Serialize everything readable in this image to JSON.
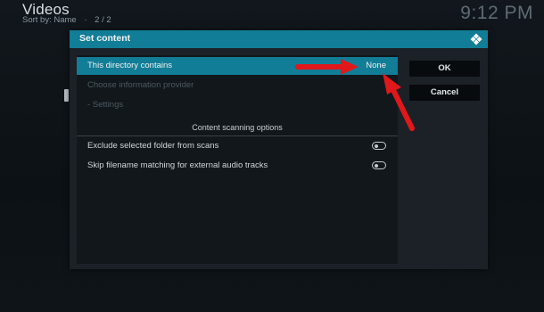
{
  "background": {
    "title": "Videos",
    "sort": "Sort by: Name",
    "page": "2 / 2",
    "clock": "9:12 PM"
  },
  "dialog": {
    "title": "Set content",
    "settings": {
      "content_label": "This directory contains",
      "content_value": "None",
      "provider_label": "Choose information provider",
      "settings_label": "- Settings",
      "section_header": "Content scanning options",
      "exclude_label": "Exclude selected folder from scans",
      "skip_label": "Skip filename matching for external audio tracks"
    },
    "buttons": {
      "ok": "OK",
      "cancel": "Cancel"
    }
  },
  "colors": {
    "accent": "#127d96",
    "dialog_bg": "#1b2126",
    "panel_bg": "#11171b",
    "arrow": "#e0171b"
  },
  "icons": [
    "kodi-logo-icon",
    "toggle-off-icon",
    "annotation-arrow"
  ]
}
